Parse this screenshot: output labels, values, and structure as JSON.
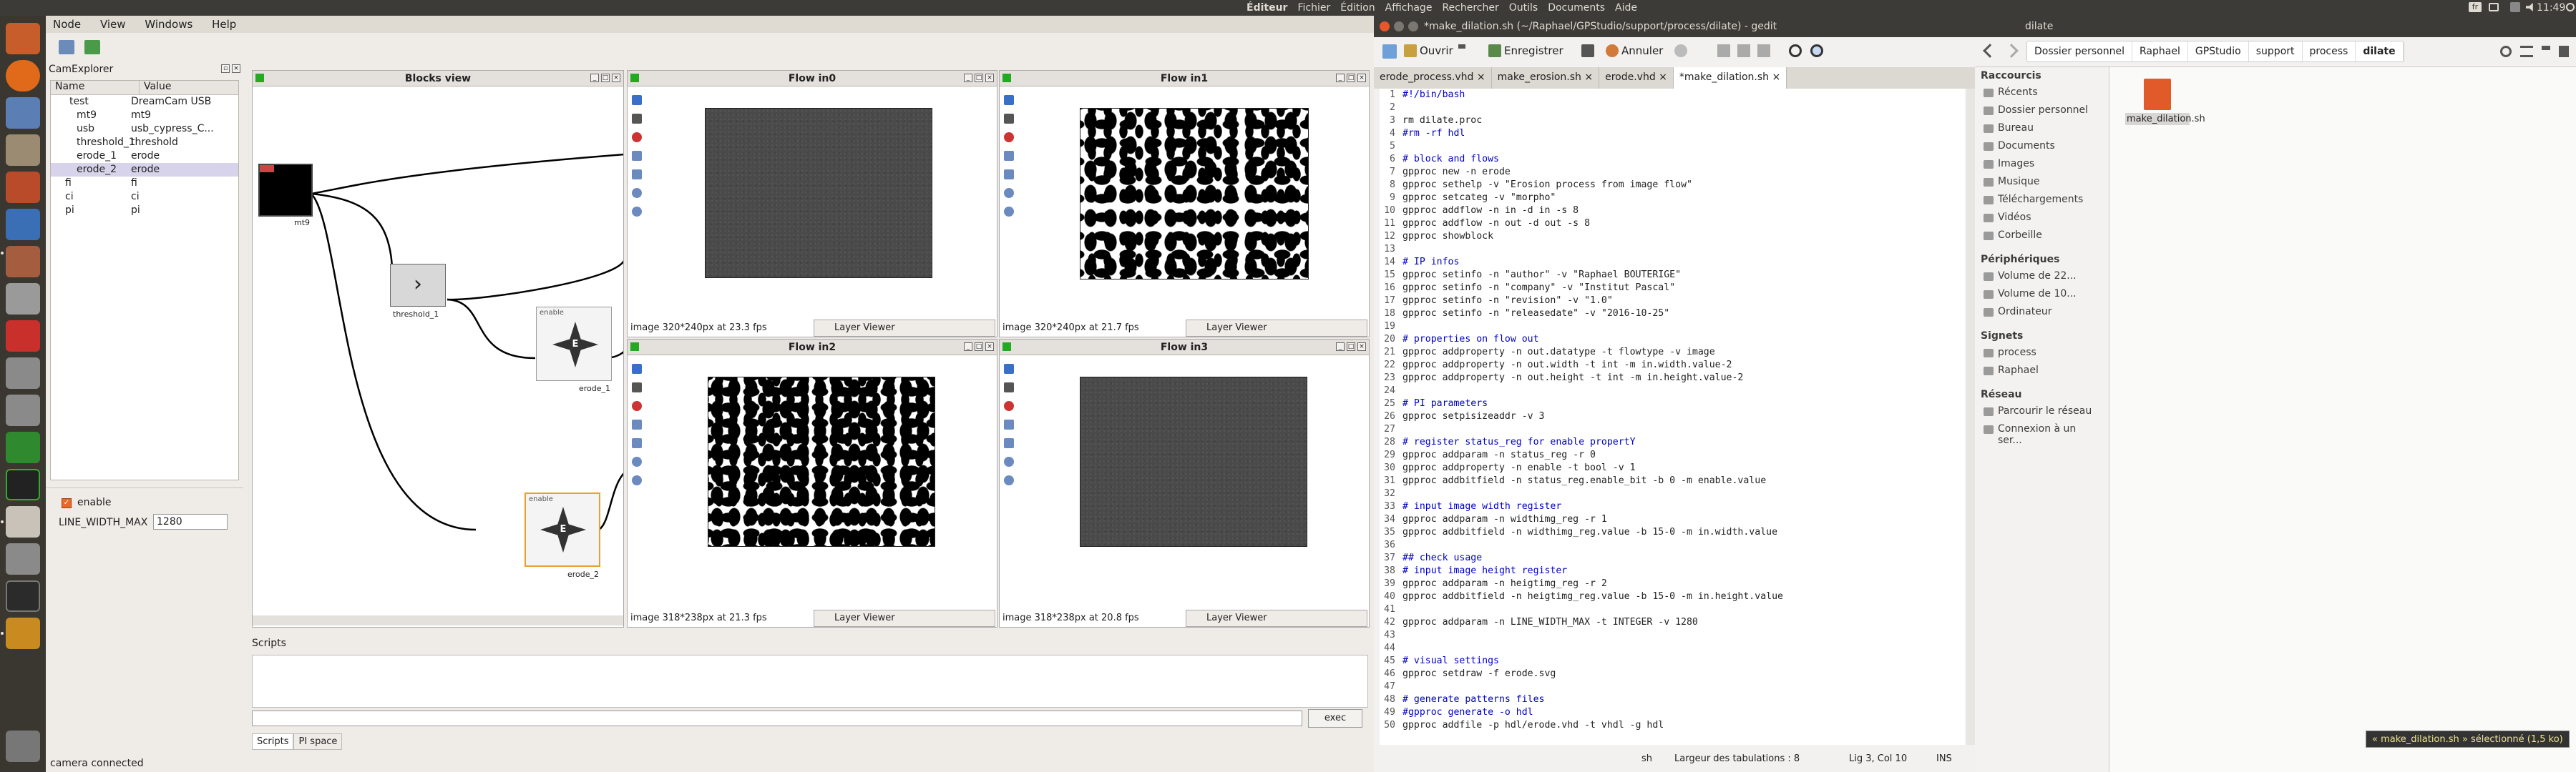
{
  "top_panel": {
    "lang": "fr",
    "time": "11:49",
    "app_menu": [
      "Éditeur",
      "Fichier",
      "Édition",
      "Affichage",
      "Rechercher",
      "Outils",
      "Documents",
      "Aide"
    ]
  },
  "gpstudio": {
    "menu": [
      "Node",
      "View",
      "Windows",
      "Help"
    ],
    "camexplorer": {
      "title": "CamExplorer",
      "headers": [
        "Name",
        "Value"
      ],
      "rows": [
        {
          "name": "test",
          "value": "DreamCam USB"
        },
        {
          "name": "mt9",
          "value": "mt9"
        },
        {
          "name": "usb",
          "value": "usb_cypress_C..."
        },
        {
          "name": "threshold_1",
          "value": "threshold"
        },
        {
          "name": "erode_1",
          "value": "erode"
        },
        {
          "name": "erode_2",
          "value": "erode"
        },
        {
          "name": "fi",
          "value": "fi"
        },
        {
          "name": "ci",
          "value": "ci"
        },
        {
          "name": "pi",
          "value": "pi"
        }
      ]
    },
    "properties": {
      "enable_label": "enable",
      "line_width_label": "LINE_WIDTH_MAX",
      "line_width_value": "1280"
    },
    "blocks_view": {
      "title": "Blocks view",
      "blocks": [
        "mt9",
        "threshold_1",
        "erode_1",
        "erode_2"
      ],
      "enable_tag": "enable"
    },
    "flows": [
      {
        "title": "Flow in0",
        "info": "image 320*240px at 23.3 fps",
        "viewer": "Layer Viewer"
      },
      {
        "title": "Flow in1",
        "info": "image 320*240px at 21.7 fps",
        "viewer": "Layer Viewer"
      },
      {
        "title": "Flow in2",
        "info": "image 318*238px at 21.3 fps",
        "viewer": "Layer Viewer"
      },
      {
        "title": "Flow in3",
        "info": "image 318*238px at 20.8 fps",
        "viewer": "Layer Viewer"
      }
    ],
    "scripts": {
      "title": "Scripts",
      "exec_label": "exec",
      "tabs": [
        "Scripts",
        "PI space"
      ]
    },
    "status": "camera connected"
  },
  "gedit": {
    "title": "*make_dilation.sh (~/Raphael/GPStudio/support/process/dilate) - gedit",
    "toolbar": {
      "open": "Ouvrir",
      "save": "Enregistrer",
      "undo": "Annuler"
    },
    "tabs": [
      "erode_process.vhd",
      "make_erosion.sh",
      "erode.vhd",
      "*make_dilation.sh"
    ],
    "lines": [
      {
        "n": "1",
        "t": "#!/bin/bash",
        "k": "cmt"
      },
      {
        "n": "2",
        "t": "",
        "k": ""
      },
      {
        "n": "3",
        "t": "rm dilate.proc",
        "k": ""
      },
      {
        "n": "4",
        "t": "#rm -rf hdl",
        "k": "cmt"
      },
      {
        "n": "5",
        "t": "",
        "k": ""
      },
      {
        "n": "6",
        "t": "# block and flows",
        "k": "cmt"
      },
      {
        "n": "7",
        "t": "gpproc new -n erode",
        "k": ""
      },
      {
        "n": "8",
        "t": "gpproc sethelp -v \"Erosion process from image flow\"",
        "k": ""
      },
      {
        "n": "9",
        "t": "gpproc setcateg -v \"morpho\"",
        "k": ""
      },
      {
        "n": "10",
        "t": "gpproc addflow -n in -d in -s 8",
        "k": ""
      },
      {
        "n": "11",
        "t": "gpproc addflow -n out -d out -s 8",
        "k": ""
      },
      {
        "n": "12",
        "t": "gpproc showblock",
        "k": ""
      },
      {
        "n": "13",
        "t": "",
        "k": ""
      },
      {
        "n": "14",
        "t": "# IP infos",
        "k": "cmt"
      },
      {
        "n": "15",
        "t": "gpproc setinfo -n \"author\" -v \"Raphael BOUTERIGE\"",
        "k": ""
      },
      {
        "n": "16",
        "t": "gpproc setinfo -n \"company\" -v \"Institut Pascal\"",
        "k": ""
      },
      {
        "n": "17",
        "t": "gpproc setinfo -n \"revision\" -v \"1.0\"",
        "k": ""
      },
      {
        "n": "18",
        "t": "gpproc setinfo -n \"releasedate\" -v \"2016-10-25\"",
        "k": ""
      },
      {
        "n": "19",
        "t": "",
        "k": ""
      },
      {
        "n": "20",
        "t": "# properties on flow out",
        "k": "cmt"
      },
      {
        "n": "21",
        "t": "gpproc addproperty -n out.datatype -t flowtype -v image",
        "k": ""
      },
      {
        "n": "22",
        "t": "gpproc addproperty -n out.width -t int -m in.width.value-2",
        "k": ""
      },
      {
        "n": "23",
        "t": "gpproc addproperty -n out.height -t int -m in.height.value-2",
        "k": ""
      },
      {
        "n": "24",
        "t": "",
        "k": ""
      },
      {
        "n": "25",
        "t": "# PI parameters",
        "k": "cmt"
      },
      {
        "n": "26",
        "t": "gpproc setpisizeaddr -v 3",
        "k": ""
      },
      {
        "n": "27",
        "t": "",
        "k": ""
      },
      {
        "n": "28",
        "t": "# register status_reg for enable propertY",
        "k": "cmt"
      },
      {
        "n": "29",
        "t": "gpproc addparam -n status_reg -r 0",
        "k": ""
      },
      {
        "n": "30",
        "t": "gpproc addproperty -n enable -t bool -v 1",
        "k": ""
      },
      {
        "n": "31",
        "t": "gpproc addbitfield -n status_reg.enable_bit -b 0 -m enable.value",
        "k": ""
      },
      {
        "n": "32",
        "t": "",
        "k": ""
      },
      {
        "n": "33",
        "t": "# input image width register",
        "k": "cmt"
      },
      {
        "n": "34",
        "t": "gpproc addparam -n widthimg_reg -r 1",
        "k": ""
      },
      {
        "n": "35",
        "t": "gpproc addbitfield -n widthimg_reg.value -b 15-0 -m in.width.value",
        "k": ""
      },
      {
        "n": "36",
        "t": "",
        "k": ""
      },
      {
        "n": "37",
        "t": "## check usage",
        "k": "cmt"
      },
      {
        "n": "38",
        "t": "# input image height register",
        "k": "cmt"
      },
      {
        "n": "39",
        "t": "gpproc addparam -n heigtimg_reg -r 2",
        "k": ""
      },
      {
        "n": "40",
        "t": "gpproc addbitfield -n heigtimg_reg.value -b 15-0 -m in.height.value",
        "k": ""
      },
      {
        "n": "41",
        "t": "",
        "k": ""
      },
      {
        "n": "42",
        "t": "gpproc addparam -n LINE_WIDTH_MAX -t INTEGER -v 1280",
        "k": ""
      },
      {
        "n": "43",
        "t": "",
        "k": ""
      },
      {
        "n": "44",
        "t": "",
        "k": ""
      },
      {
        "n": "45",
        "t": "# visual settings",
        "k": "cmt"
      },
      {
        "n": "46",
        "t": "gpproc setdraw -f erode.svg",
        "k": ""
      },
      {
        "n": "47",
        "t": "",
        "k": ""
      },
      {
        "n": "48",
        "t": "# generate patterns files",
        "k": "cmt"
      },
      {
        "n": "49",
        "t": "#gpproc generate -o hdl",
        "k": "cmt"
      },
      {
        "n": "50",
        "t": "gpproc addfile -p hdl/erode.vhd -t vhdl -g hdl",
        "k": ""
      }
    ],
    "status": {
      "lang": "sh",
      "tabwidth": "Largeur des tabulations : 8",
      "position": "Lig 3, Col 10",
      "mode": "INS"
    }
  },
  "filemanager": {
    "title": "dilate",
    "breadcrumbs": [
      "Dossier personnel",
      "Raphael",
      "GPStudio",
      "support",
      "process",
      "dilate"
    ],
    "sections": [
      {
        "header": "Raccourcis",
        "items": [
          "Récents",
          "Dossier personnel",
          "Bureau",
          "Documents",
          "Images",
          "Musique",
          "Téléchargements",
          "Vidéos",
          "Corbeille"
        ]
      },
      {
        "header": "Périphériques",
        "items": [
          "Volume de 22...",
          "Volume de 10...",
          "Ordinateur"
        ]
      },
      {
        "header": "Signets",
        "items": [
          "process",
          "Raphael"
        ]
      },
      {
        "header": "Réseau",
        "items": [
          "Parcourir le réseau",
          "Connexion à un ser..."
        ]
      }
    ],
    "file": "make_dilation.sh",
    "status": "« make_dilation.sh » sélectionné (1,5 ko)"
  }
}
